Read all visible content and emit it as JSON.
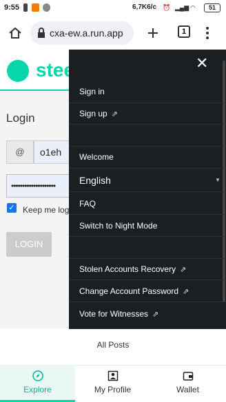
{
  "status_bar": {
    "time": "9:55",
    "network_speed": "6,7K6/c",
    "battery": "51"
  },
  "browser": {
    "url": "cxa-ew.a.run.app",
    "tab_count": "1"
  },
  "page": {
    "logo_text": "stee",
    "login_title": "Login",
    "at_symbol": "@",
    "username_value": "o1eh",
    "password_mask": "••••••••••••••••••••",
    "keep_logged_label": "Keep me log",
    "login_button": "LOGIN"
  },
  "menu": {
    "items": [
      {
        "label": "Sign in"
      },
      {
        "label": "Sign up"
      },
      {
        "label": "Welcome"
      },
      {
        "label": "English"
      },
      {
        "label": "FAQ"
      },
      {
        "label": "Switch to Night Mode"
      },
      {
        "label": "Stolen Accounts Recovery"
      },
      {
        "label": "Change Account Password"
      },
      {
        "label": "Vote for Witnesses"
      }
    ]
  },
  "all_posts": "All Posts",
  "bottom_nav": {
    "explore": "Explore",
    "profile": "My Profile",
    "wallet": "Wallet"
  },
  "colors": {
    "brand": "#06d6a9",
    "menu_bg": "#1c1f22",
    "checkbox": "#1a73e8"
  },
  "icons": [
    "home-icon",
    "lock-icon",
    "plus-icon",
    "tabs-icon",
    "more-icon",
    "close-icon",
    "external-link-icon",
    "compass-icon",
    "profile-icon",
    "wallet-icon"
  ]
}
